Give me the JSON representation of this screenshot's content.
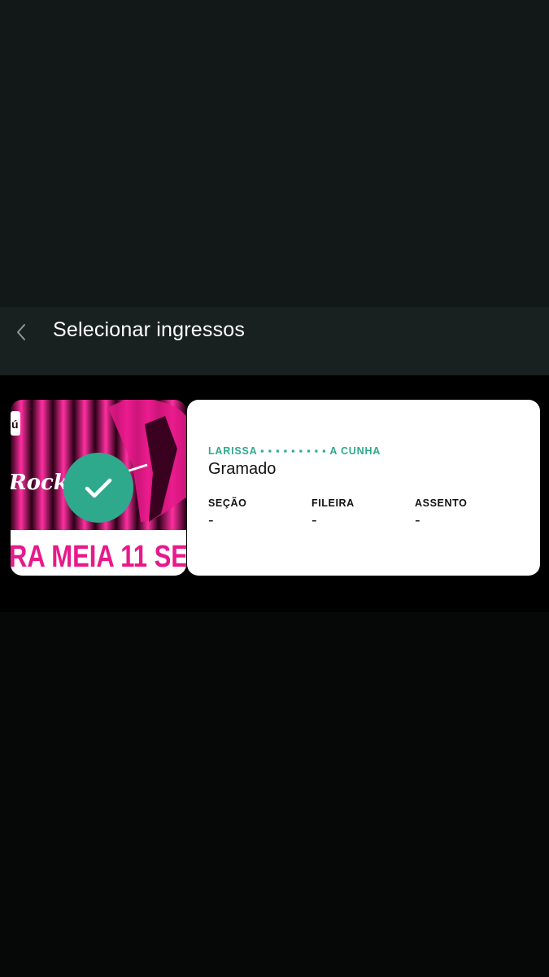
{
  "header": {
    "title": "Selecionar ingressos",
    "back_icon": "chevron-left-icon"
  },
  "ticket": {
    "selected": true,
    "status_icon": "checkmark-icon",
    "banner": {
      "brand_text": "ú",
      "logo_text": "Rock",
      "promo_text": "RA MEIA 11 SE",
      "colors": {
        "primary": "#e8198b",
        "dark": "#3a0020"
      }
    },
    "holder_name": "LARISSA ▪ ▪ ▪ ▪ ▪ ▪ ▪ ▪ ▪ A CUNHA",
    "event_name": "Gramado",
    "fields": [
      {
        "label": "SEÇÃO",
        "value": "-"
      },
      {
        "label": "FILEIRA",
        "value": "-"
      },
      {
        "label": "ASSENTO",
        "value": "-"
      }
    ]
  },
  "colors": {
    "accent": "#2fa98c",
    "nav_background": "#182020",
    "background": "#060808"
  }
}
